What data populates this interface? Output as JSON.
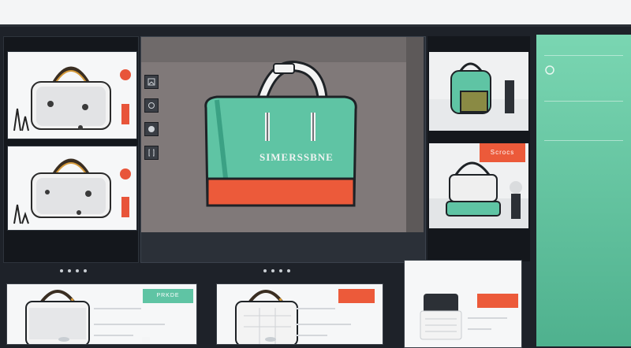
{
  "topbar": {
    "tabs": [
      "",
      "",
      "",
      ""
    ]
  },
  "left": {
    "header_left": "",
    "header_right": ""
  },
  "viewer": {
    "title": "",
    "product_label": "SIMERSSBNE",
    "footer": "",
    "tools": [
      "image-icon",
      "circle-icon",
      "sphere-icon",
      "bracket-icon"
    ]
  },
  "right": {
    "header": "",
    "mid": "",
    "tag": "Scrocs"
  },
  "teal_panel": {
    "rows": [
      "",
      "",
      "",
      ""
    ]
  },
  "bottom": {
    "cards": [
      {
        "pill": "PRKDE",
        "pill_color": "#5fc4a4"
      },
      {
        "pill": "",
        "pill_color": "#ec5a3a"
      },
      {
        "pill": "",
        "pill_color": "#ec5a3a"
      }
    ],
    "card3_header": ""
  },
  "colors": {
    "teal": "#5fc4a4",
    "orange": "#ec5a3a",
    "dark": "#1e2229"
  }
}
